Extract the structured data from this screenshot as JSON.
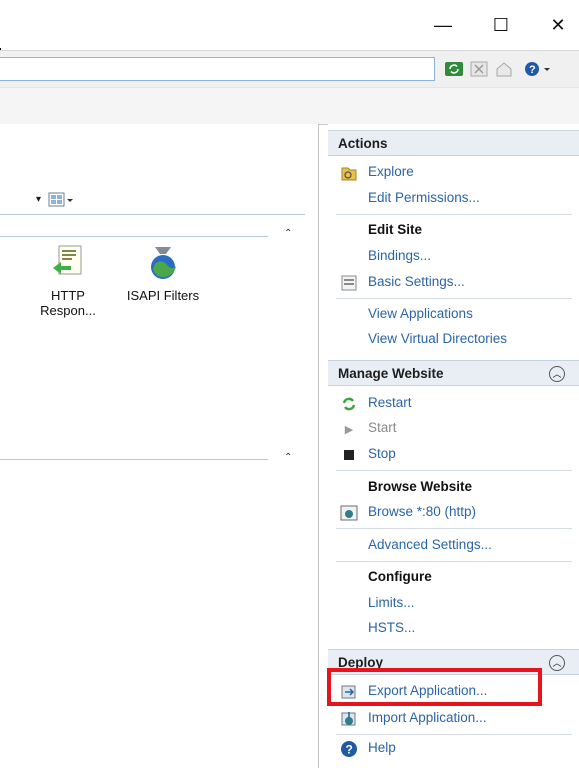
{
  "window": {
    "minimize": "—",
    "maximize": "☐",
    "close": "✕"
  },
  "center": {
    "features": [
      {
        "label": "HTTP\nRespon...",
        "line1": "HTTP",
        "line2": "Respon...",
        "icon": "http-response-icon"
      },
      {
        "label": "ISAPI Filters",
        "icon": "isapi-filters-icon"
      }
    ],
    "collapse_glyph": "⌃"
  },
  "actions": {
    "title": "Actions",
    "explore": "Explore",
    "edit_permissions": "Edit Permissions...",
    "edit_site": "Edit Site",
    "bindings": "Bindings...",
    "basic_settings": "Basic Settings...",
    "view_applications": "View Applications",
    "view_virtual_directories": "View Virtual Directories",
    "manage_website": "Manage Website",
    "restart": "Restart",
    "start": "Start",
    "stop": "Stop",
    "browse_website": "Browse Website",
    "browse_80": "Browse *:80 (http)",
    "advanced_settings": "Advanced Settings...",
    "configure": "Configure",
    "limits": "Limits...",
    "hsts": "HSTS...",
    "deploy": "Deploy",
    "export_application": "Export Application...",
    "import_application": "Import Application...",
    "help": "Help"
  },
  "colors": {
    "link": "#2a64a8",
    "highlight": "#e8141d",
    "header_bg": "#e9eef5"
  }
}
